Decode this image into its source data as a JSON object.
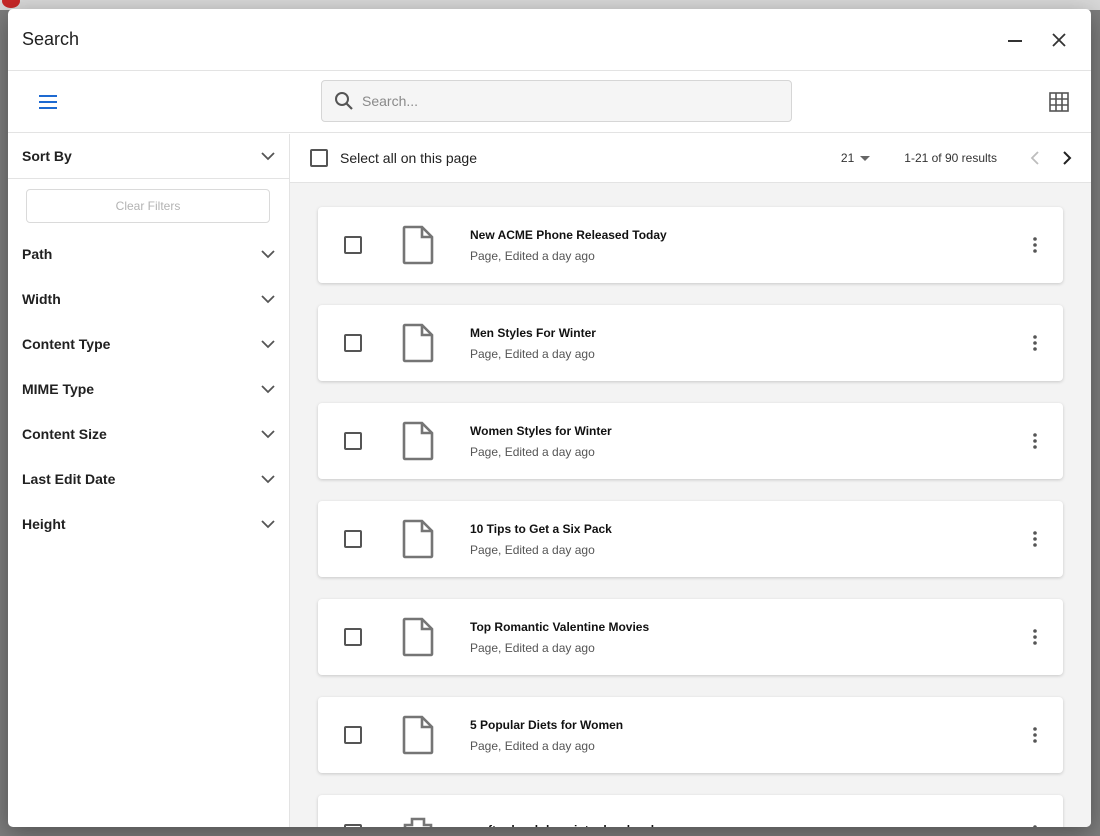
{
  "dialog": {
    "title": "Search",
    "minimize_icon": "minimize-icon",
    "close_icon": "close-icon"
  },
  "toolbar": {
    "menu_icon": "hamburger-menu-icon",
    "search_placeholder": "Search...",
    "search_value": "",
    "view_icon": "grid-view-icon"
  },
  "sidebar": {
    "sort_label": "Sort By",
    "clear_filters": "Clear Filters",
    "filters": [
      {
        "label": "Path"
      },
      {
        "label": "Width"
      },
      {
        "label": "Content Type"
      },
      {
        "label": "MIME Type"
      },
      {
        "label": "Content Size"
      },
      {
        "label": "Last Edit Date"
      },
      {
        "label": "Height"
      }
    ]
  },
  "results_header": {
    "select_all_label": "Select all on this page",
    "per_page": "21",
    "results_text": "1-21 of 90 results"
  },
  "items": [
    {
      "name": "New ACME Phone Released Today",
      "meta": "Page, Edited a day ago",
      "icon": "page-file-icon"
    },
    {
      "name": "Men Styles For Winter",
      "meta": "Page, Edited a day ago",
      "icon": "page-file-icon"
    },
    {
      "name": "Women Styles for Winter",
      "meta": "Page, Edited a day ago",
      "icon": "page-file-icon"
    },
    {
      "name": "10 Tips to Get a Six Pack",
      "meta": "Page, Edited a day ago",
      "icon": "page-file-icon"
    },
    {
      "name": "Top Romantic Valentine Movies",
      "meta": "Page, Edited a day ago",
      "icon": "page-file-icon"
    },
    {
      "name": "5 Popular Diets for Women",
      "meta": "Page, Edited a day ago",
      "icon": "page-file-icon"
    },
    {
      "name": "crafter-level-descriptor.level.xml",
      "meta": "",
      "icon": "component-icon"
    }
  ],
  "colors": {
    "accent": "#1e6ad1",
    "icon_gray": "#757575"
  }
}
